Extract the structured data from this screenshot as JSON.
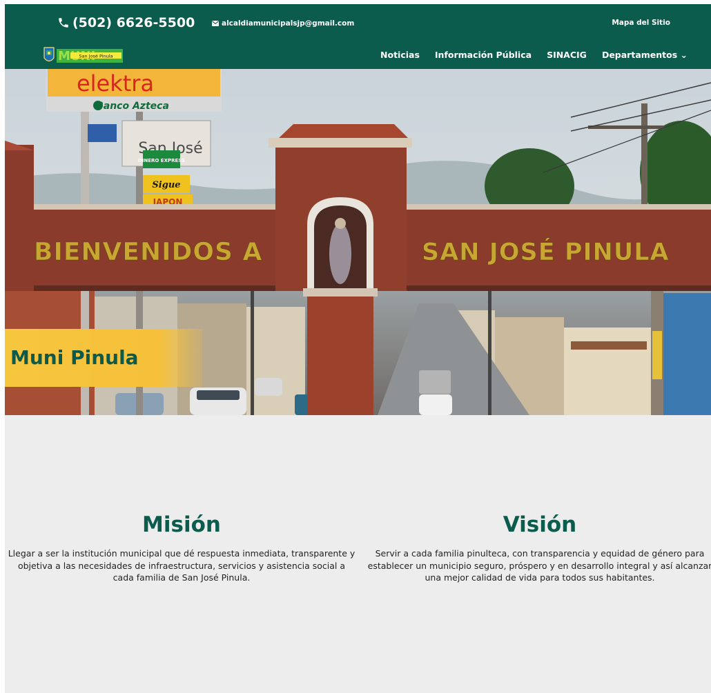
{
  "header": {
    "phone": "(502) 6626-5500",
    "email": "alcaldiamunicipalsjp@gmail.com",
    "sitemap_link": "Mapa del Sitio",
    "logo_text": "MUNI",
    "logo_subtext": "San José Pinula",
    "nav": [
      {
        "label": "Noticias"
      },
      {
        "label": "Información Pública"
      },
      {
        "label": "SINACIG"
      },
      {
        "label": "Departamentos"
      }
    ]
  },
  "hero": {
    "title": "Muni Pinula",
    "arch_left_text": "BIENVENIDOS A",
    "arch_right_text": "SAN JOSÉ PINULA",
    "signs": {
      "store": "elektra",
      "bank": "Banco Azteca",
      "billboard": "San José",
      "shop1": "DINERO EXPRESS",
      "shop2": "Sigue",
      "shop3": "JAPON"
    }
  },
  "mision": {
    "title": "Misión",
    "text": "Llegar a ser la institución municipal que dé respuesta inmediata, transparente y objetiva a las necesidades de infraestructura, servicios y asistencia social a cada familia de San José Pinula."
  },
  "vision": {
    "title": "Visión",
    "text": "Servir a cada familia pinulteca, con transparencia y equidad de género para establecer un municipio seguro, próspero y en desarrollo integral y así alcanzar una mejor calidad de vida para todos sus habitantes."
  },
  "colors": {
    "header_bg": "#0c5c4d",
    "accent_yellow": "#f6c03a",
    "page_bg": "#ededed",
    "brick": "#8a3b2b"
  },
  "icons": {
    "phone": "phone-icon",
    "email": "envelope-icon",
    "dropdown": "chevron-down-icon"
  }
}
